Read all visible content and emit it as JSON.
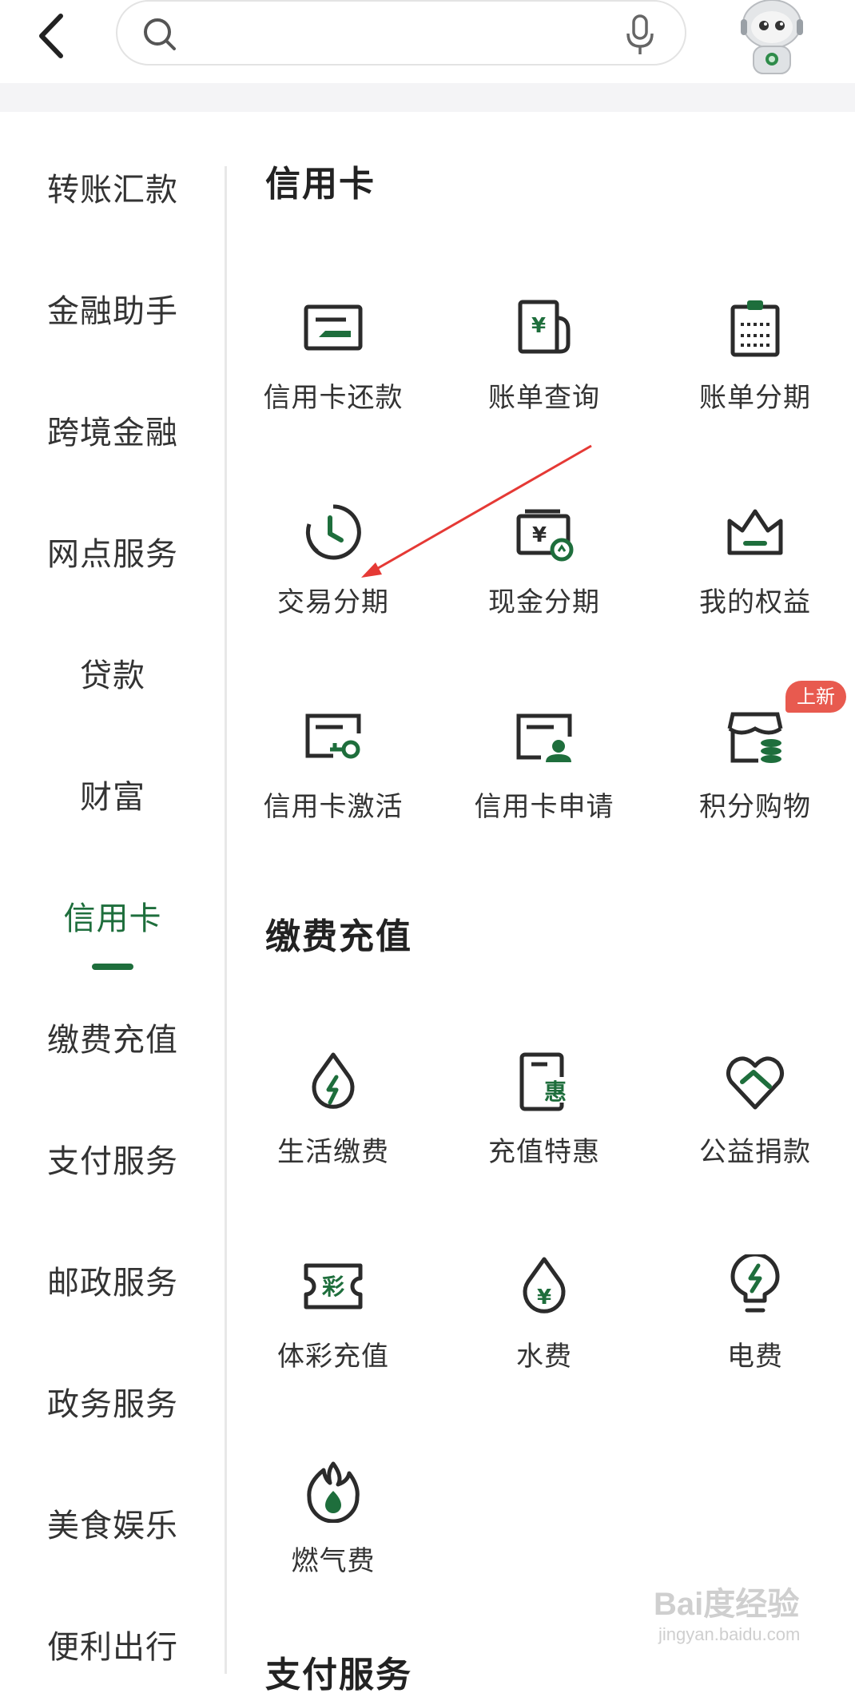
{
  "header": {
    "search_placeholder": ""
  },
  "sidebar": {
    "items": [
      {
        "label": "转账汇款"
      },
      {
        "label": "金融助手"
      },
      {
        "label": "跨境金融"
      },
      {
        "label": "网点服务"
      },
      {
        "label": "贷款"
      },
      {
        "label": "财富"
      },
      {
        "label": "信用卡",
        "active": true
      },
      {
        "label": "缴费充值"
      },
      {
        "label": "支付服务"
      },
      {
        "label": "邮政服务"
      },
      {
        "label": "政务服务"
      },
      {
        "label": "美食娱乐"
      },
      {
        "label": "便利出行"
      }
    ]
  },
  "sections": [
    {
      "title": "信用卡",
      "items": [
        {
          "label": "信用卡还款",
          "icon": "card-repay-icon"
        },
        {
          "label": "账单查询",
          "icon": "bill-query-icon"
        },
        {
          "label": "账单分期",
          "icon": "bill-installment-icon"
        },
        {
          "label": "交易分期",
          "icon": "clock-icon"
        },
        {
          "label": "现金分期",
          "icon": "cash-installment-icon"
        },
        {
          "label": "我的权益",
          "icon": "crown-icon"
        },
        {
          "label": "信用卡激活",
          "icon": "card-key-icon"
        },
        {
          "label": "信用卡申请",
          "icon": "card-apply-icon"
        },
        {
          "label": "积分购物",
          "icon": "points-shop-icon",
          "badge": "上新"
        }
      ]
    },
    {
      "title": "缴费充值",
      "items": [
        {
          "label": "生活缴费",
          "icon": "life-payment-icon"
        },
        {
          "label": "充值特惠",
          "icon": "recharge-deal-icon"
        },
        {
          "label": "公益捐款",
          "icon": "heart-hand-icon"
        },
        {
          "label": "体彩充值",
          "icon": "lottery-ticket-icon"
        },
        {
          "label": "水费",
          "icon": "water-drop-icon"
        },
        {
          "label": "电费",
          "icon": "bulb-icon"
        },
        {
          "label": "燃气费",
          "icon": "flame-icon"
        }
      ]
    }
  ],
  "next_section_title": "支付服务",
  "watermark": {
    "line1": "Bai度经验",
    "line2": "jingyan.baidu.com"
  },
  "colors": {
    "accent": "#1e6e3c",
    "icon": "#2b2b2b",
    "badge": "#e85a4f",
    "annotation_arrow": "#e53935"
  }
}
